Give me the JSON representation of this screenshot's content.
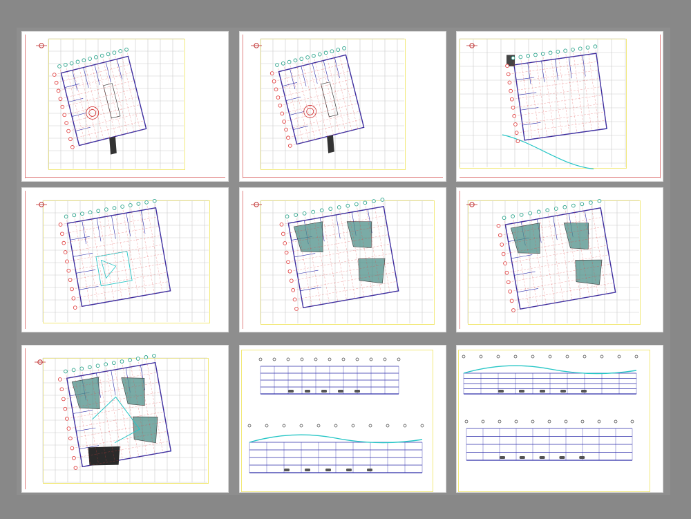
{
  "view": {
    "title": "",
    "background": "#888888"
  },
  "colors": {
    "grid": "#c9c9c9",
    "frame": "#f2e97a",
    "wall": "#2a2aa8",
    "axis": "#e04040",
    "bubble": "#29a38a",
    "cyan": "#26c6c6",
    "dark": "#3a3a3a",
    "teal_fill": "#4e8f88"
  },
  "sheets": [
    {
      "id": "s1",
      "kind": "plan",
      "variant": "basement",
      "label": ""
    },
    {
      "id": "s2",
      "kind": "plan",
      "variant": "basement-2",
      "label": ""
    },
    {
      "id": "s3",
      "kind": "plan",
      "variant": "site",
      "label": ""
    },
    {
      "id": "s4",
      "kind": "plan",
      "variant": "ground",
      "label": ""
    },
    {
      "id": "s5",
      "kind": "plan",
      "variant": "first",
      "label": ""
    },
    {
      "id": "s6",
      "kind": "plan",
      "variant": "second",
      "label": ""
    },
    {
      "id": "s7",
      "kind": "plan",
      "variant": "roof",
      "label": ""
    },
    {
      "id": "s8",
      "kind": "section",
      "variant": "sections-a",
      "label": ""
    },
    {
      "id": "s9",
      "kind": "section",
      "variant": "sections-b",
      "label": ""
    }
  ]
}
